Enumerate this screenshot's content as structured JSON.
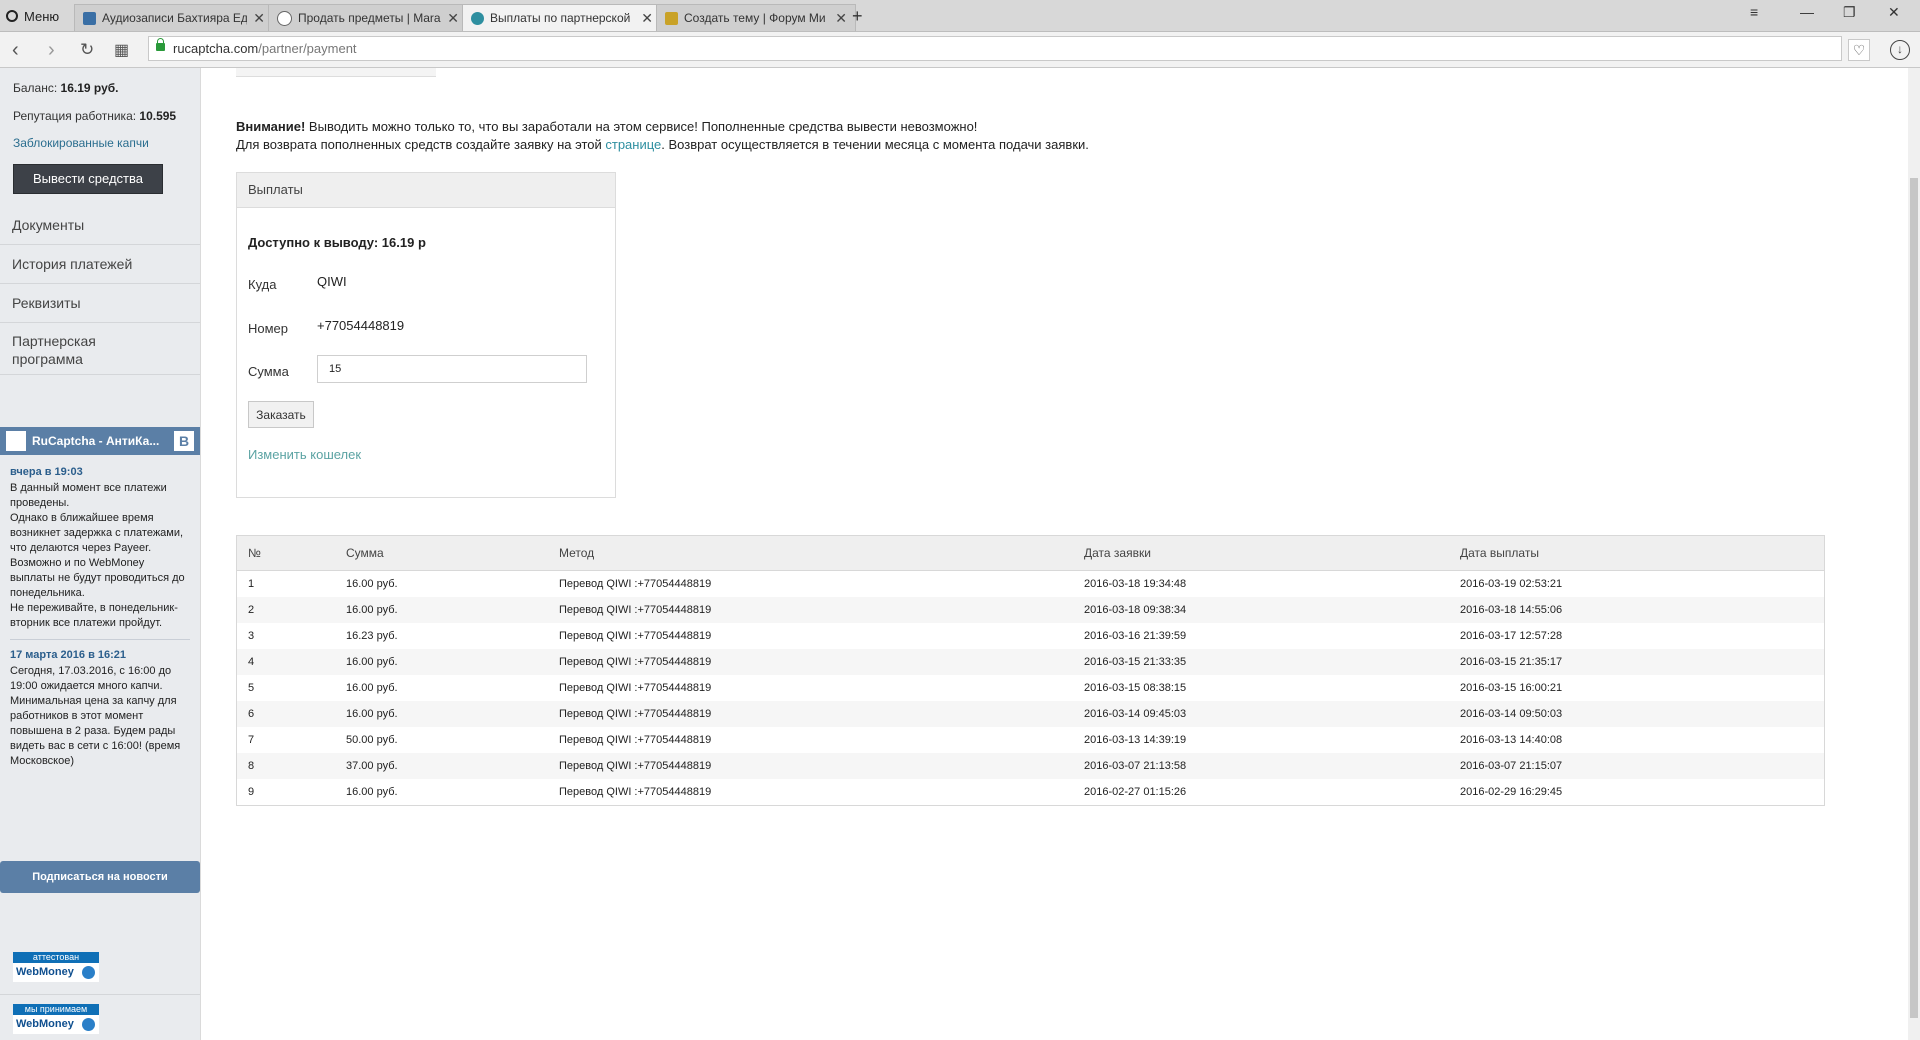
{
  "browser": {
    "menu_label": "Меню",
    "tabs": [
      {
        "title": "Аудиозаписи Бахтияра Ед",
        "color": "#3a6fa5"
      },
      {
        "title": "Продать предметы | Mara",
        "color": "#666666"
      },
      {
        "title": "Выплаты по партнерской",
        "color": "#2e8fa0"
      },
      {
        "title": "Создать тему | Форум Ми",
        "color": "#c9a227"
      }
    ],
    "url_host": "rucaptcha.com",
    "url_path": "/partner/payment"
  },
  "sidebar": {
    "balance_label": "Баланс: ",
    "balance_value": "16.19 руб.",
    "reputation_label": "Репутация работника: ",
    "reputation_value": "10.595",
    "blocked_link": "Заблокированные капчи",
    "withdraw_button": "Вывести средства",
    "menu": [
      "Документы",
      "История платежей",
      "Реквизиты",
      "Партнерская программа"
    ]
  },
  "vk_widget": {
    "title": "RuCaptcha - АнтиКа...",
    "vk_icon": "B",
    "posts": [
      {
        "date": "вчера в 19:03",
        "text": "В данный момент все платежи проведены.\nОднако в ближайшее время возникнет задержка с платежами, что делаются через Payeer. Возможно и по WebMoney выплаты не будут проводиться до понедельника.\nНе переживайте, в понедельник-вторник все платежи пройдут."
      },
      {
        "date": "17 марта 2016 в 16:21",
        "text": "Сегодня, 17.03.2016, с 16:00 до 19:00 ожидается много капчи. Минимальная цена за капчу для работников в этот момент повышена в 2 раза. Будем рады видеть вас в сети с 16:00! (время Московское)"
      }
    ],
    "subscribe_button": "Подписаться на новости"
  },
  "badges": [
    {
      "top": "аттестован",
      "bottom": "WebMoney"
    },
    {
      "top": "мы принимаем",
      "bottom": "WebMoney"
    }
  ],
  "notice": {
    "bold": "Внимание!",
    "line1": " Выводить можно только то, что вы заработали на этом сервисе! Пополненные средства вывести невозможно!",
    "line2_pre": "Для возврата пополненных средств создайте заявку на этой ",
    "line2_link": "странице",
    "line2_post": ". Возврат осуществляется в течении месяца с момента подачи заявки."
  },
  "payout_panel": {
    "title": "Выплаты",
    "available": "Доступно к выводу: 16.19 р",
    "where_label": "Куда",
    "where_value": "QIWI",
    "number_label": "Номер",
    "number_value": "+77054448819",
    "amount_label": "Сумма",
    "amount_value": "15",
    "order_button": "Заказать",
    "change_wallet_link": "Изменить кошелек"
  },
  "payments_table": {
    "headers": [
      "№",
      "Сумма",
      "Метод",
      "Дата заявки",
      "Дата выплаты"
    ],
    "rows": [
      [
        "1",
        "16.00 руб.",
        "Перевод QIWI :+77054448819",
        "2016-03-18 19:34:48",
        "2016-03-19 02:53:21"
      ],
      [
        "2",
        "16.00 руб.",
        "Перевод QIWI :+77054448819",
        "2016-03-18 09:38:34",
        "2016-03-18 14:55:06"
      ],
      [
        "3",
        "16.23 руб.",
        "Перевод QIWI :+77054448819",
        "2016-03-16 21:39:59",
        "2016-03-17 12:57:28"
      ],
      [
        "4",
        "16.00 руб.",
        "Перевод QIWI :+77054448819",
        "2016-03-15 21:33:35",
        "2016-03-15 21:35:17"
      ],
      [
        "5",
        "16.00 руб.",
        "Перевод QIWI :+77054448819",
        "2016-03-15 08:38:15",
        "2016-03-15 16:00:21"
      ],
      [
        "6",
        "16.00 руб.",
        "Перевод QIWI :+77054448819",
        "2016-03-14 09:45:03",
        "2016-03-14 09:50:03"
      ],
      [
        "7",
        "50.00 руб.",
        "Перевод QIWI :+77054448819",
        "2016-03-13 14:39:19",
        "2016-03-13 14:40:08"
      ],
      [
        "8",
        "37.00 руб.",
        "Перевод QIWI :+77054448819",
        "2016-03-07 21:13:58",
        "2016-03-07 21:15:07"
      ],
      [
        "9",
        "16.00 руб.",
        "Перевод QIWI :+77054448819",
        "2016-02-27 01:15:26",
        "2016-02-29 16:29:45"
      ]
    ]
  }
}
